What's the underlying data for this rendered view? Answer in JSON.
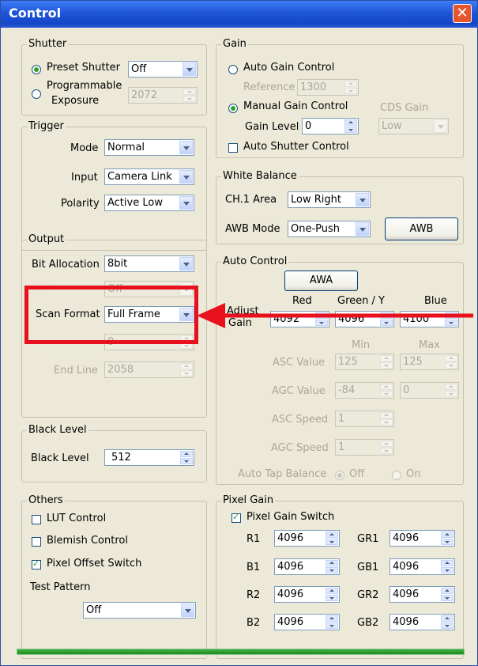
{
  "window": {
    "title": "Control"
  },
  "shutter": {
    "legend": "Shutter",
    "preset_label": "Preset Shutter",
    "preset_value": "Off",
    "programmable_label_1": "Programmable",
    "programmable_label_2": "Exposure",
    "programmable_value": "2072"
  },
  "trigger": {
    "legend": "Trigger",
    "mode_label": "Mode",
    "mode_value": "Normal",
    "input_label": "Input",
    "input_value": "Camera Link",
    "polarity_label": "Polarity",
    "polarity_value": "Active Low"
  },
  "output": {
    "legend": "Output",
    "bit_allocation_label": "Bit Allocation",
    "bit_allocation_value": "8bit",
    "hidden_row_value": "Off",
    "scan_format_label": "Scan Format",
    "scan_format_value": "Full Frame",
    "start_line_value": "0",
    "end_line_label": "End Line",
    "end_line_value": "2058"
  },
  "black_level": {
    "legend": "Black Level",
    "label": "Black Level",
    "value": "512"
  },
  "others": {
    "legend": "Others",
    "lut_label": "LUT Control",
    "blemish_label": "Blemish Control",
    "pixel_offset_label": "Pixel Offset Switch",
    "test_pattern_label": "Test Pattern",
    "test_pattern_value": "Off"
  },
  "gain": {
    "legend": "Gain",
    "auto_label": "Auto Gain Control",
    "reference_label": "Reference",
    "reference_value": "1300",
    "manual_label": "Manual Gain Control",
    "cds_label": "CDS Gain",
    "cds_value": "Low",
    "gain_level_label": "Gain Level",
    "gain_level_value": "0",
    "auto_shutter_label": "Auto Shutter Control"
  },
  "white_balance": {
    "legend": "White Balance",
    "ch1_label": "CH.1 Area",
    "ch1_value": "Low Right",
    "awb_mode_label": "AWB Mode",
    "awb_mode_value": "One-Push",
    "awb_button": "AWB"
  },
  "auto_control": {
    "legend": "Auto Control",
    "awa_button": "AWA",
    "red_header": "Red",
    "green_header": "Green / Y",
    "blue_header": "Blue",
    "adjust_label_1": "Adjust",
    "adjust_label_2": "Gain",
    "red_value": "4092",
    "green_value": "4096",
    "blue_value": "4100",
    "min_header": "Min",
    "max_header": "Max",
    "asc_value_label": "ASC Value",
    "asc_min": "125",
    "asc_max": "125",
    "agc_value_label": "AGC Value",
    "agc_min": "-84",
    "agc_max": "0",
    "asc_speed_label": "ASC Speed",
    "asc_speed": "1",
    "agc_speed_label": "AGC Speed",
    "agc_speed": "1",
    "tap_balance_label": "Auto Tap Balance",
    "tap_off": "Off",
    "tap_on": "On"
  },
  "pixel_gain": {
    "legend": "Pixel Gain",
    "switch_label": "Pixel Gain Switch",
    "rows": [
      {
        "left_label": "R1",
        "left_value": "4096",
        "right_label": "GR1",
        "right_value": "4096"
      },
      {
        "left_label": "B1",
        "left_value": "4096",
        "right_label": "GB1",
        "right_value": "4096"
      },
      {
        "left_label": "R2",
        "left_value": "4096",
        "right_label": "GR2",
        "right_value": "4096"
      },
      {
        "left_label": "B2",
        "left_value": "4096",
        "right_label": "GB2",
        "right_value": "4096"
      }
    ]
  },
  "colors": {
    "annotation": "#e8101c",
    "titlebar": "#1f56d8",
    "progress": "#2f9e2f"
  }
}
